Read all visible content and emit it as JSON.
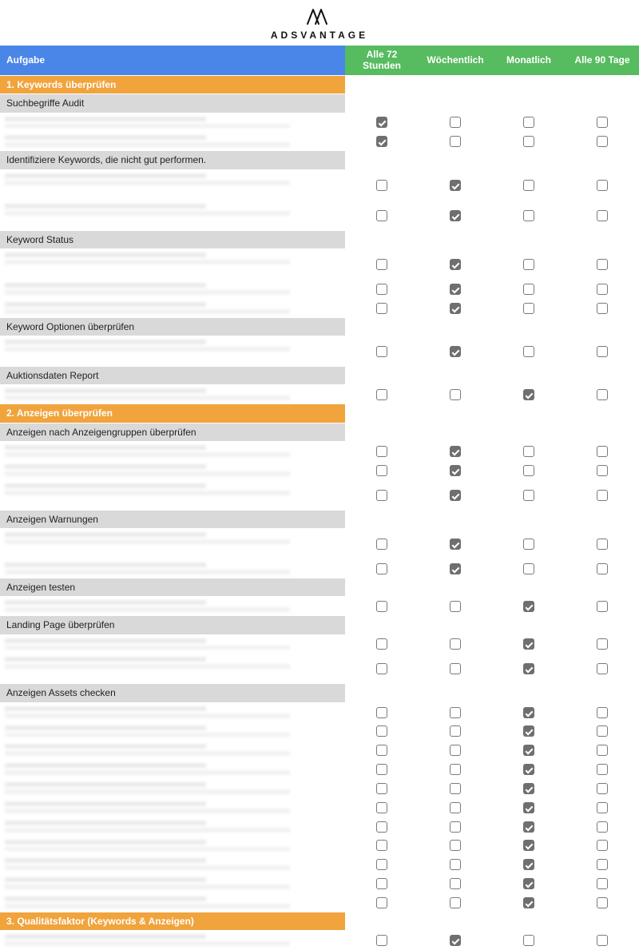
{
  "brand": {
    "name": "ADSVANTAGE"
  },
  "columns": {
    "task": "Aufgabe",
    "c1": "Alle 72 Stunden",
    "c2": "Wöchentlich",
    "c3": "Monatlich",
    "c4": "Alle 90 Tage"
  },
  "rows": [
    {
      "type": "section",
      "label": "1. Keywords überprüfen"
    },
    {
      "type": "subhead",
      "label": "Suchbegriffe Audit"
    },
    {
      "type": "data",
      "blur": true,
      "checks": [
        true,
        false,
        false,
        false
      ]
    },
    {
      "type": "data",
      "blur": true,
      "checks": [
        true,
        false,
        false,
        false
      ]
    },
    {
      "type": "subhead",
      "label": "Identifiziere Keywords, die nicht gut performen."
    },
    {
      "type": "data",
      "blur": true,
      "tall": true,
      "checks": [
        false,
        true,
        false,
        false
      ]
    },
    {
      "type": "data",
      "blur": true,
      "tall": true,
      "checks": [
        false,
        true,
        false,
        false
      ]
    },
    {
      "type": "subhead",
      "label": "Keyword Status"
    },
    {
      "type": "data",
      "blur": true,
      "tall": true,
      "checks": [
        false,
        true,
        false,
        false
      ]
    },
    {
      "type": "data",
      "blur": true,
      "checks": [
        false,
        true,
        false,
        false
      ]
    },
    {
      "type": "data",
      "blur": true,
      "checks": [
        false,
        true,
        false,
        false
      ]
    },
    {
      "type": "subhead",
      "label": "Keyword Optionen überprüfen"
    },
    {
      "type": "data",
      "blur": true,
      "tall": true,
      "checks": [
        false,
        true,
        false,
        false
      ]
    },
    {
      "type": "subhead",
      "label": "Auktionsdaten Report"
    },
    {
      "type": "data",
      "blur": true,
      "checks": [
        false,
        false,
        true,
        false
      ]
    },
    {
      "type": "section",
      "label": "2. Anzeigen überprüfen"
    },
    {
      "type": "subhead",
      "label": "Anzeigen nach Anzeigengruppen überprüfen"
    },
    {
      "type": "data",
      "blur": true,
      "checks": [
        false,
        true,
        false,
        false
      ]
    },
    {
      "type": "data",
      "blur": true,
      "checks": [
        false,
        true,
        false,
        false
      ]
    },
    {
      "type": "data",
      "blur": true,
      "tall": true,
      "checks": [
        false,
        true,
        false,
        false
      ]
    },
    {
      "type": "subhead",
      "label": "Anzeigen Warnungen"
    },
    {
      "type": "data",
      "blur": true,
      "tall": true,
      "checks": [
        false,
        true,
        false,
        false
      ]
    },
    {
      "type": "data",
      "blur": true,
      "checks": [
        false,
        true,
        false,
        false
      ]
    },
    {
      "type": "subhead",
      "label": "Anzeigen testen"
    },
    {
      "type": "data",
      "blur": true,
      "checks": [
        false,
        false,
        true,
        false
      ]
    },
    {
      "type": "subhead",
      "label": "Landing Page überprüfen"
    },
    {
      "type": "data",
      "blur": true,
      "checks": [
        false,
        false,
        true,
        false
      ]
    },
    {
      "type": "data",
      "blur": true,
      "tall": true,
      "checks": [
        false,
        false,
        true,
        false
      ]
    },
    {
      "type": "subhead",
      "label": "Anzeigen Assets checken"
    },
    {
      "type": "data",
      "blur": true,
      "checks": [
        false,
        false,
        true,
        false
      ]
    },
    {
      "type": "data",
      "blur": true,
      "checks": [
        false,
        false,
        true,
        false
      ]
    },
    {
      "type": "data",
      "blur": true,
      "checks": [
        false,
        false,
        true,
        false
      ]
    },
    {
      "type": "data",
      "blur": true,
      "checks": [
        false,
        false,
        true,
        false
      ]
    },
    {
      "type": "data",
      "blur": true,
      "checks": [
        false,
        false,
        true,
        false
      ]
    },
    {
      "type": "data",
      "blur": true,
      "checks": [
        false,
        false,
        true,
        false
      ]
    },
    {
      "type": "data",
      "blur": true,
      "checks": [
        false,
        false,
        true,
        false
      ]
    },
    {
      "type": "data",
      "blur": true,
      "checks": [
        false,
        false,
        true,
        false
      ]
    },
    {
      "type": "data",
      "blur": true,
      "checks": [
        false,
        false,
        true,
        false
      ]
    },
    {
      "type": "data",
      "blur": true,
      "checks": [
        false,
        false,
        true,
        false
      ]
    },
    {
      "type": "data",
      "blur": true,
      "checks": [
        false,
        false,
        true,
        false
      ]
    },
    {
      "type": "section",
      "label": "3. Qualitätsfaktor (Keywords & Anzeigen)"
    },
    {
      "type": "data",
      "blur": true,
      "checks": [
        false,
        true,
        false,
        false
      ]
    }
  ]
}
